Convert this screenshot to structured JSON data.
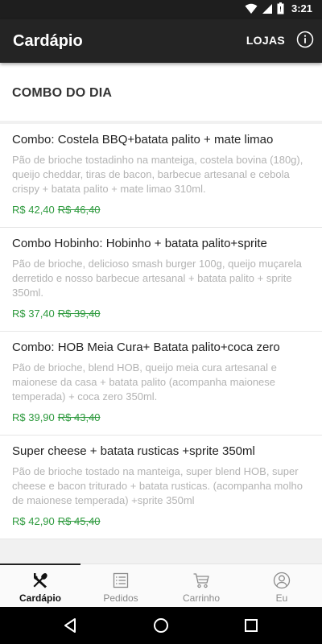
{
  "status_bar": {
    "time": "3:21"
  },
  "app_bar": {
    "title": "Cardápio",
    "stores_label": "LOJAS"
  },
  "section": {
    "title": "COMBO DO DIA"
  },
  "items": [
    {
      "name": "Combo: Costela BBQ+batata palito + mate limao",
      "description": "Pão de brioche tostadinho na manteiga, costela bovina (180g), queijo cheddar, tiras de bacon, barbecue artesanal e cebola crispy + batata palito + mate limao 310ml.",
      "price": "R$ 42,40",
      "old_price": "R$ 46,40"
    },
    {
      "name": "Combo Hobinho: Hobinho + batata palito+sprite",
      "description": "Pão de brioche, delicioso smash burger 100g, queijo muçarela derretido e nosso barbecue artesanal + batata palito + sprite 350ml.",
      "price": "R$ 37,40",
      "old_price": "R$ 39,40"
    },
    {
      "name": "Combo: HOB Meia Cura+ Batata palito+coca zero",
      "description": "Pão de brioche, blend HOB, queijo meia cura artesanal e maionese da casa + batata palito (acompanha maionese temperada) + coca zero 350ml.",
      "price": "R$ 39,90",
      "old_price": "R$ 43,40"
    },
    {
      "name": "Super cheese + batata rusticas +sprite 350ml",
      "description": "Pão de brioche tostado na manteiga, super blend HOB, super cheese e bacon triturado + batata rusticas. (acompanha molho de maionese temperada) +sprite 350ml",
      "price": "R$ 42,90",
      "old_price": "R$ 45,40"
    }
  ],
  "bottom_nav": {
    "tabs": [
      {
        "label": "Cardápio",
        "icon": "cutlery-icon",
        "active": true
      },
      {
        "label": "Pedidos",
        "icon": "list-icon",
        "active": false
      },
      {
        "label": "Carrinho",
        "icon": "cart-icon",
        "active": false
      },
      {
        "label": "Eu",
        "icon": "user-icon",
        "active": false
      }
    ]
  },
  "colors": {
    "app_bar": "#242424",
    "price_green": "#2e9a3e",
    "description_gray": "#b3b3b3"
  }
}
